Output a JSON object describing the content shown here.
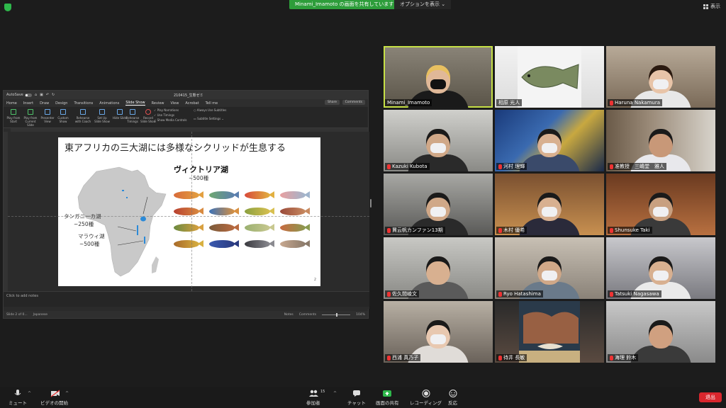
{
  "top_bar": {
    "sharing_banner": "Minami_Imamoto の画面を共有しています",
    "view_options": "オプションを表示",
    "view_options_caret": "⌄",
    "display_button": "表示"
  },
  "powerpoint": {
    "autosave_label": "AutoSave",
    "file_name": "210415_生態ゼミ",
    "tabs": [
      "Home",
      "Insert",
      "Draw",
      "Design",
      "Transitions",
      "Animations",
      "Slide Show",
      "Review",
      "View",
      "Acrobat",
      "Tell me"
    ],
    "active_tab": "Slide Show",
    "share_label": "Share",
    "comments_label": "Comments",
    "ribbon_buttons": [
      "Play from Start",
      "Play from Current Slide",
      "Presenter View",
      "Custom Show",
      "Rehearse with Coach",
      "Set Up Slide Show",
      "Hide Slide",
      "Rehearse Timings",
      "Record Slide Show"
    ],
    "ribbon_checks": [
      "Play Narrations",
      "Use Timings",
      "Show Media Controls"
    ],
    "subtitle_checks": [
      "Always Use Subtitles",
      "Subtitle Settings"
    ],
    "notes_placeholder": "Click to add notes",
    "status_slide": "Slide 2 of 0...",
    "status_language": "Japanese",
    "status_notes": "Notes",
    "status_comments": "Comments",
    "status_zoom": "104%"
  },
  "slide": {
    "title": "東アフリカの三大湖には多様なシクリッドが生息する",
    "victoria_label": "ヴィクトリア湖",
    "victoria_count": "~500種",
    "tanganyika_label": "タンガニーカ湖",
    "tanganyika_count": "~250種",
    "malawi_label": "マラウィ湖",
    "malawi_count": "~500種",
    "page_number": "2"
  },
  "participants": [
    {
      "name": "Minami_Imamoto",
      "muted": false,
      "active": true
    },
    {
      "name": "相原 光人",
      "muted": false,
      "active": false
    },
    {
      "name": "Haruna Nakamura",
      "muted": true,
      "active": false
    },
    {
      "name": "Kazuki Kubota",
      "muted": true,
      "active": false
    },
    {
      "name": "河村 理輝",
      "muted": true,
      "active": false
    },
    {
      "name": "准教授　三嶋堂　雅人",
      "muted": true,
      "active": false
    },
    {
      "name": "賈云帆カンファン13期",
      "muted": true,
      "active": false
    },
    {
      "name": "木村 優希",
      "muted": true,
      "active": false
    },
    {
      "name": "Shunsuke Taki",
      "muted": true,
      "active": false
    },
    {
      "name": "佐久間崚文",
      "muted": true,
      "active": false
    },
    {
      "name": "Ryo Hatashima",
      "muted": true,
      "active": false
    },
    {
      "name": "Tatsuki Nagasawa",
      "muted": true,
      "active": false
    },
    {
      "name": "西浦 真乃子",
      "muted": true,
      "active": false
    },
    {
      "name": "待井 長敏",
      "muted": true,
      "active": false
    },
    {
      "name": "海理 鈴木",
      "muted": true,
      "active": false
    }
  ],
  "toolbar": {
    "mute_label": "ミュート",
    "video_label": "ビデオの開始",
    "participants_label": "参加者",
    "participants_count": "15",
    "chat_label": "チャット",
    "share_screen_label": "画面の共有",
    "recording_label": "レコーディング",
    "reactions_label": "反応",
    "leave_label": "退出"
  },
  "colors": {
    "active_speaker": "#c6e046",
    "share_banner": "#2d9d3a",
    "leave": "#d9262d",
    "mic_off": "#e33333"
  }
}
